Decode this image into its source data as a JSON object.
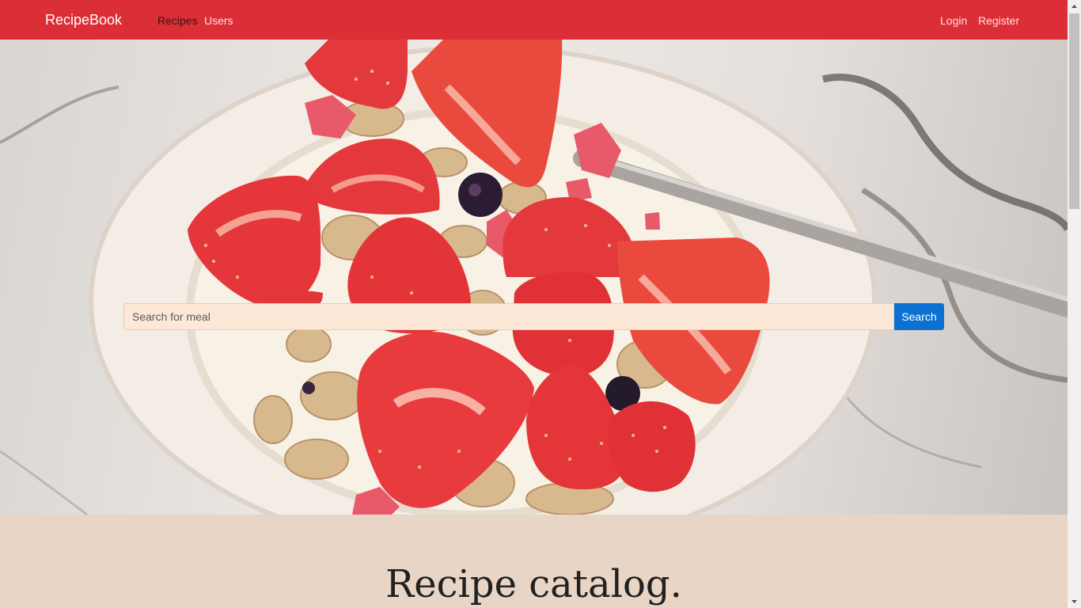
{
  "nav": {
    "brand": "RecipeBook",
    "links": [
      "Recipes",
      "Users"
    ],
    "auth": [
      "Login",
      "Register"
    ]
  },
  "hero": {
    "image": "strawberry-granola-yogurt-bowl",
    "search": {
      "placeholder": "Search for meal",
      "value": "",
      "button": "Search"
    }
  },
  "catalog": {
    "title": "Recipe catalog."
  },
  "colors": {
    "navbar": "#dc2e36",
    "page_background": "#e8d5c6",
    "search_button": "#0b72d1",
    "search_input": "#fde8d8"
  }
}
